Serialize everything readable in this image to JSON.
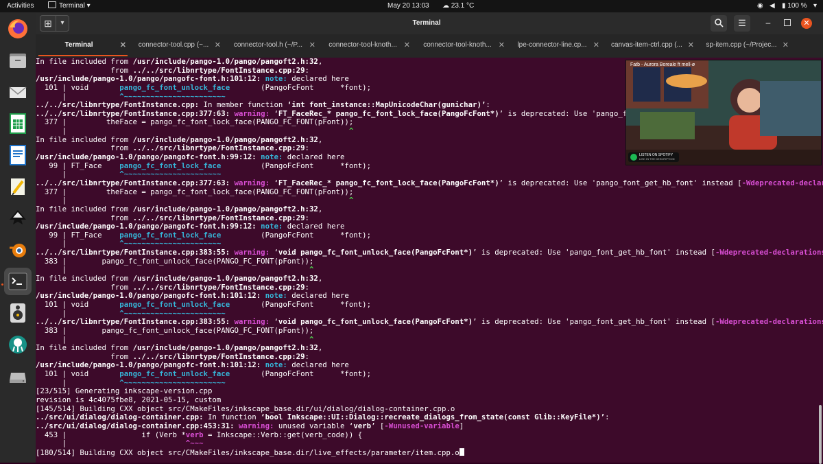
{
  "top_bar": {
    "activities": "Activities",
    "app_name": "Terminal",
    "datetime": "May 20  13:03",
    "weather": "23.1 °C",
    "battery": "100 %"
  },
  "window": {
    "title": "Terminal"
  },
  "tabs": [
    {
      "label": "Terminal",
      "active": true
    },
    {
      "label": "connector-tool.cpp (~...",
      "active": false
    },
    {
      "label": "connector-tool.h (~/P...",
      "active": false
    },
    {
      "label": "connector-tool-knoth...",
      "active": false
    },
    {
      "label": "connector-tool-knoth...",
      "active": false
    },
    {
      "label": "lpe-connector-line.cp...",
      "active": false
    },
    {
      "label": "canvas-item-ctrl.cpp (...",
      "active": false
    },
    {
      "label": "sp-item.cpp (~/Projec...",
      "active": false
    }
  ],
  "dock": [
    "firefox-icon",
    "files-icon",
    "mail-icon",
    "spreadsheet-icon",
    "writer-icon",
    "text-editor-icon",
    "inkscape-icon",
    "blender-icon",
    "terminal-icon",
    "rhythmbox-icon",
    "gitkraken-icon",
    "drive-icon"
  ],
  "video": {
    "title": "Fatb - Aurora Boreale ft mell-ø",
    "spotify_line1": "LISTEN ON SPOTIFY",
    "spotify_line2": "LINK IN THE DESCRIPTION"
  },
  "terminal": {
    "lines": [
      [
        {
          "t": "In file included from "
        },
        {
          "t": "/usr/include/pango-1.0/pango/pangoft2.h:32",
          "c": "b"
        },
        {
          "t": ","
        }
      ],
      [
        {
          "t": "                 from "
        },
        {
          "t": "../../src/libnrtype/FontInstance.cpp:29",
          "c": "b"
        },
        {
          "t": ":"
        }
      ],
      [
        {
          "t": "/usr/include/pango-1.0/pango/pangofc-font.h:101:12:",
          "c": "b"
        },
        {
          "t": " "
        },
        {
          "t": "note:",
          "c": "note"
        },
        {
          "t": " declared here"
        }
      ],
      [
        {
          "t": "  101 | void       "
        },
        {
          "t": "pango_fc_font_unlock_face",
          "c": "note"
        },
        {
          "t": "       (PangoFcFont      *font);"
        }
      ],
      [
        {
          "t": "      |            "
        },
        {
          "t": "^~~~~~~~~~~~~~~~~~~~~~~~",
          "c": "note"
        }
      ],
      [
        {
          "t": "../../src/libnrtype/FontInstance.cpp:",
          "c": "b"
        },
        {
          "t": " In member function "
        },
        {
          "t": "‘int font_instance::MapUnicodeChar(gunichar)’",
          "c": "b"
        },
        {
          "t": ":"
        }
      ],
      [
        {
          "t": "../../src/libnrtype/FontInstance.cpp:377:63:",
          "c": "b"
        },
        {
          "t": " "
        },
        {
          "t": "warning:",
          "c": "warn"
        },
        {
          "t": " ‘"
        },
        {
          "t": "FT_FaceRec_* pango_fc_font_lock_face(PangoFcFont*)",
          "c": "b"
        },
        {
          "t": "’ is deprecated: Use 'pango_font_get_hb"
        }
      ],
      [
        {
          "t": "  377 |         theFace = pango_fc_font_lock_face(PANGO_FC_FONT(pFont));"
        }
      ],
      [
        {
          "t": "      |                                                                ",
          "c": ""
        },
        {
          "t": "^",
          "c": "grn"
        }
      ],
      [
        {
          "t": "In file included from "
        },
        {
          "t": "/usr/include/pango-1.0/pango/pangoft2.h:32",
          "c": "b"
        },
        {
          "t": ","
        }
      ],
      [
        {
          "t": "                 from "
        },
        {
          "t": "../../src/libnrtype/FontInstance.cpp:29",
          "c": "b"
        },
        {
          "t": ":"
        }
      ],
      [
        {
          "t": "/usr/include/pango-1.0/pango/pangofc-font.h:99:12:",
          "c": "b"
        },
        {
          "t": " "
        },
        {
          "t": "note:",
          "c": "note"
        },
        {
          "t": " declared here"
        }
      ],
      [
        {
          "t": "   99 | FT_Face    "
        },
        {
          "t": "pango_fc_font_lock_face",
          "c": "note"
        },
        {
          "t": "         (PangoFcFont      *font);"
        }
      ],
      [
        {
          "t": "      |            "
        },
        {
          "t": "^~~~~~~~~~~~~~~~~~~~~~~",
          "c": "note"
        }
      ],
      [
        {
          "t": "../../src/libnrtype/FontInstance.cpp:377:63:",
          "c": "b"
        },
        {
          "t": " "
        },
        {
          "t": "warning:",
          "c": "warn"
        },
        {
          "t": " ‘"
        },
        {
          "t": "FT_FaceRec_* pango_fc_font_lock_face(PangoFcFont*)",
          "c": "b"
        },
        {
          "t": "’ is deprecated: Use 'pango_font_get_hb_font' instead ["
        },
        {
          "t": "-Wdeprecated-declarations",
          "c": "mag"
        },
        {
          "t": "]"
        }
      ],
      [
        {
          "t": "  377 |         theFace = pango_fc_font_lock_face(PANGO_FC_FONT(pFont));"
        }
      ],
      [
        {
          "t": "      |                                                                "
        },
        {
          "t": "^",
          "c": "grn"
        }
      ],
      [
        {
          "t": "In file included from "
        },
        {
          "t": "/usr/include/pango-1.0/pango/pangoft2.h:32",
          "c": "b"
        },
        {
          "t": ","
        }
      ],
      [
        {
          "t": "                 from "
        },
        {
          "t": "../../src/libnrtype/FontInstance.cpp:29",
          "c": "b"
        },
        {
          "t": ":"
        }
      ],
      [
        {
          "t": "/usr/include/pango-1.0/pango/pangofc-font.h:99:12:",
          "c": "b"
        },
        {
          "t": " "
        },
        {
          "t": "note:",
          "c": "note"
        },
        {
          "t": " declared here"
        }
      ],
      [
        {
          "t": "   99 | FT_Face    "
        },
        {
          "t": "pango_fc_font_lock_face",
          "c": "note"
        },
        {
          "t": "         (PangoFcFont      *font);"
        }
      ],
      [
        {
          "t": "      |            "
        },
        {
          "t": "^~~~~~~~~~~~~~~~~~~~~~~",
          "c": "note"
        }
      ],
      [
        {
          "t": "../../src/libnrtype/FontInstance.cpp:383:55:",
          "c": "b"
        },
        {
          "t": " "
        },
        {
          "t": "warning:",
          "c": "warn"
        },
        {
          "t": " ‘"
        },
        {
          "t": "void pango_fc_font_unlock_face(PangoFcFont*)",
          "c": "b"
        },
        {
          "t": "’ is deprecated: Use 'pango_font_get_hb_font' instead ["
        },
        {
          "t": "-Wdeprecated-declarations",
          "c": "mag"
        },
        {
          "t": "]"
        }
      ],
      [
        {
          "t": "  383 |        pango_fc_font_unlock_face(PANGO_FC_FONT(pFont));"
        }
      ],
      [
        {
          "t": "      |                                                       "
        },
        {
          "t": "^",
          "c": "grn"
        }
      ],
      [
        {
          "t": "In file included from "
        },
        {
          "t": "/usr/include/pango-1.0/pango/pangoft2.h:32",
          "c": "b"
        },
        {
          "t": ","
        }
      ],
      [
        {
          "t": "                 from "
        },
        {
          "t": "../../src/libnrtype/FontInstance.cpp:29",
          "c": "b"
        },
        {
          "t": ":"
        }
      ],
      [
        {
          "t": "/usr/include/pango-1.0/pango/pangofc-font.h:101:12:",
          "c": "b"
        },
        {
          "t": " "
        },
        {
          "t": "note:",
          "c": "note"
        },
        {
          "t": " declared here"
        }
      ],
      [
        {
          "t": "  101 | void       "
        },
        {
          "t": "pango_fc_font_unlock_face",
          "c": "note"
        },
        {
          "t": "       (PangoFcFont      *font);"
        }
      ],
      [
        {
          "t": "      |            "
        },
        {
          "t": "^~~~~~~~~~~~~~~~~~~~~~~~",
          "c": "note"
        }
      ],
      [
        {
          "t": "../../src/libnrtype/FontInstance.cpp:383:55:",
          "c": "b"
        },
        {
          "t": " "
        },
        {
          "t": "warning:",
          "c": "warn"
        },
        {
          "t": " ‘"
        },
        {
          "t": "void pango_fc_font_unlock_face(PangoFcFont*)",
          "c": "b"
        },
        {
          "t": "’ is deprecated: Use 'pango_font_get_hb_font' instead ["
        },
        {
          "t": "-Wdeprecated-declarations",
          "c": "mag"
        },
        {
          "t": "]"
        }
      ],
      [
        {
          "t": "  383 |        pango_fc_font_unlock_face(PANGO_FC_FONT(pFont));"
        }
      ],
      [
        {
          "t": "      |                                                       "
        },
        {
          "t": "^",
          "c": "grn"
        }
      ],
      [
        {
          "t": "In file included from "
        },
        {
          "t": "/usr/include/pango-1.0/pango/pangoft2.h:32",
          "c": "b"
        },
        {
          "t": ","
        }
      ],
      [
        {
          "t": "                 from "
        },
        {
          "t": "../../src/libnrtype/FontInstance.cpp:29",
          "c": "b"
        },
        {
          "t": ":"
        }
      ],
      [
        {
          "t": "/usr/include/pango-1.0/pango/pangofc-font.h:101:12:",
          "c": "b"
        },
        {
          "t": " "
        },
        {
          "t": "note:",
          "c": "note"
        },
        {
          "t": " declared here"
        }
      ],
      [
        {
          "t": "  101 | void       "
        },
        {
          "t": "pango_fc_font_unlock_face",
          "c": "note"
        },
        {
          "t": "       (PangoFcFont      *font);"
        }
      ],
      [
        {
          "t": "      |            "
        },
        {
          "t": "^~~~~~~~~~~~~~~~~~~~~~~~",
          "c": "note"
        }
      ],
      [
        {
          "t": "[23/515] Generating inkscape-version.cpp"
        }
      ],
      [
        {
          "t": "revision is 4c4075fbe8, 2021-05-15, custom"
        }
      ],
      [
        {
          "t": "[145/514] Building CXX object src/CMakeFiles/inkscape_base.dir/ui/dialog/dialog-container.cpp.o"
        }
      ],
      [
        {
          "t": "../src/ui/dialog/dialog-container.cpp:",
          "c": "b"
        },
        {
          "t": " In function "
        },
        {
          "t": "‘bool Inkscape::UI::Dialog::recreate_dialogs_from_state(const Glib::KeyFile*)’",
          "c": "b"
        },
        {
          "t": ":"
        }
      ],
      [
        {
          "t": "../src/ui/dialog/dialog-container.cpp:453:31:",
          "c": "b"
        },
        {
          "t": " "
        },
        {
          "t": "warning:",
          "c": "warn"
        },
        {
          "t": " unused variable ‘"
        },
        {
          "t": "verb",
          "c": "b"
        },
        {
          "t": "’ ["
        },
        {
          "t": "-Wunused-variable",
          "c": "mag"
        },
        {
          "t": "]"
        }
      ],
      [
        {
          "t": "  453 |                 if (Verb *"
        },
        {
          "t": "verb",
          "c": "warn"
        },
        {
          "t": " = Inkscape::Verb::get(verb_code)) {"
        }
      ],
      [
        {
          "t": "      |                           "
        },
        {
          "t": "^~~~",
          "c": "warn"
        }
      ],
      [
        {
          "t": "[180/514] Building CXX object src/CMakeFiles/inkscape_base.dir/live_effects/parameter/item.cpp.o"
        }
      ]
    ]
  }
}
